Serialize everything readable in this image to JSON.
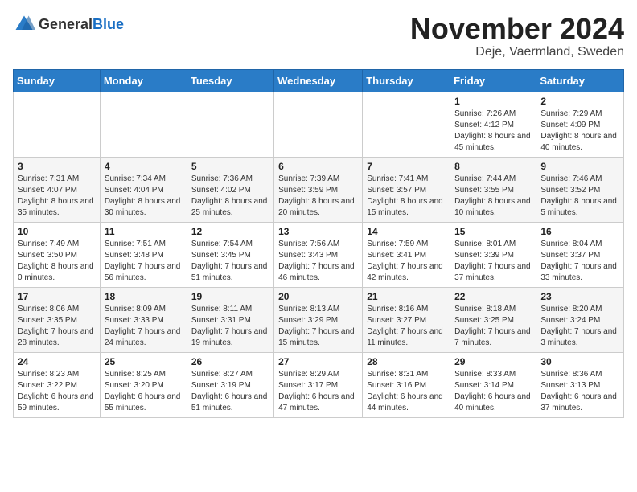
{
  "logo": {
    "general": "General",
    "blue": "Blue"
  },
  "title": "November 2024",
  "location": "Deje, Vaermland, Sweden",
  "weekdays": [
    "Sunday",
    "Monday",
    "Tuesday",
    "Wednesday",
    "Thursday",
    "Friday",
    "Saturday"
  ],
  "weeks": [
    [
      {
        "day": "",
        "info": ""
      },
      {
        "day": "",
        "info": ""
      },
      {
        "day": "",
        "info": ""
      },
      {
        "day": "",
        "info": ""
      },
      {
        "day": "",
        "info": ""
      },
      {
        "day": "1",
        "info": "Sunrise: 7:26 AM\nSunset: 4:12 PM\nDaylight: 8 hours and 45 minutes."
      },
      {
        "day": "2",
        "info": "Sunrise: 7:29 AM\nSunset: 4:09 PM\nDaylight: 8 hours and 40 minutes."
      }
    ],
    [
      {
        "day": "3",
        "info": "Sunrise: 7:31 AM\nSunset: 4:07 PM\nDaylight: 8 hours and 35 minutes."
      },
      {
        "day": "4",
        "info": "Sunrise: 7:34 AM\nSunset: 4:04 PM\nDaylight: 8 hours and 30 minutes."
      },
      {
        "day": "5",
        "info": "Sunrise: 7:36 AM\nSunset: 4:02 PM\nDaylight: 8 hours and 25 minutes."
      },
      {
        "day": "6",
        "info": "Sunrise: 7:39 AM\nSunset: 3:59 PM\nDaylight: 8 hours and 20 minutes."
      },
      {
        "day": "7",
        "info": "Sunrise: 7:41 AM\nSunset: 3:57 PM\nDaylight: 8 hours and 15 minutes."
      },
      {
        "day": "8",
        "info": "Sunrise: 7:44 AM\nSunset: 3:55 PM\nDaylight: 8 hours and 10 minutes."
      },
      {
        "day": "9",
        "info": "Sunrise: 7:46 AM\nSunset: 3:52 PM\nDaylight: 8 hours and 5 minutes."
      }
    ],
    [
      {
        "day": "10",
        "info": "Sunrise: 7:49 AM\nSunset: 3:50 PM\nDaylight: 8 hours and 0 minutes."
      },
      {
        "day": "11",
        "info": "Sunrise: 7:51 AM\nSunset: 3:48 PM\nDaylight: 7 hours and 56 minutes."
      },
      {
        "day": "12",
        "info": "Sunrise: 7:54 AM\nSunset: 3:45 PM\nDaylight: 7 hours and 51 minutes."
      },
      {
        "day": "13",
        "info": "Sunrise: 7:56 AM\nSunset: 3:43 PM\nDaylight: 7 hours and 46 minutes."
      },
      {
        "day": "14",
        "info": "Sunrise: 7:59 AM\nSunset: 3:41 PM\nDaylight: 7 hours and 42 minutes."
      },
      {
        "day": "15",
        "info": "Sunrise: 8:01 AM\nSunset: 3:39 PM\nDaylight: 7 hours and 37 minutes."
      },
      {
        "day": "16",
        "info": "Sunrise: 8:04 AM\nSunset: 3:37 PM\nDaylight: 7 hours and 33 minutes."
      }
    ],
    [
      {
        "day": "17",
        "info": "Sunrise: 8:06 AM\nSunset: 3:35 PM\nDaylight: 7 hours and 28 minutes."
      },
      {
        "day": "18",
        "info": "Sunrise: 8:09 AM\nSunset: 3:33 PM\nDaylight: 7 hours and 24 minutes."
      },
      {
        "day": "19",
        "info": "Sunrise: 8:11 AM\nSunset: 3:31 PM\nDaylight: 7 hours and 19 minutes."
      },
      {
        "day": "20",
        "info": "Sunrise: 8:13 AM\nSunset: 3:29 PM\nDaylight: 7 hours and 15 minutes."
      },
      {
        "day": "21",
        "info": "Sunrise: 8:16 AM\nSunset: 3:27 PM\nDaylight: 7 hours and 11 minutes."
      },
      {
        "day": "22",
        "info": "Sunrise: 8:18 AM\nSunset: 3:25 PM\nDaylight: 7 hours and 7 minutes."
      },
      {
        "day": "23",
        "info": "Sunrise: 8:20 AM\nSunset: 3:24 PM\nDaylight: 7 hours and 3 minutes."
      }
    ],
    [
      {
        "day": "24",
        "info": "Sunrise: 8:23 AM\nSunset: 3:22 PM\nDaylight: 6 hours and 59 minutes."
      },
      {
        "day": "25",
        "info": "Sunrise: 8:25 AM\nSunset: 3:20 PM\nDaylight: 6 hours and 55 minutes."
      },
      {
        "day": "26",
        "info": "Sunrise: 8:27 AM\nSunset: 3:19 PM\nDaylight: 6 hours and 51 minutes."
      },
      {
        "day": "27",
        "info": "Sunrise: 8:29 AM\nSunset: 3:17 PM\nDaylight: 6 hours and 47 minutes."
      },
      {
        "day": "28",
        "info": "Sunrise: 8:31 AM\nSunset: 3:16 PM\nDaylight: 6 hours and 44 minutes."
      },
      {
        "day": "29",
        "info": "Sunrise: 8:33 AM\nSunset: 3:14 PM\nDaylight: 6 hours and 40 minutes."
      },
      {
        "day": "30",
        "info": "Sunrise: 8:36 AM\nSunset: 3:13 PM\nDaylight: 6 hours and 37 minutes."
      }
    ]
  ]
}
